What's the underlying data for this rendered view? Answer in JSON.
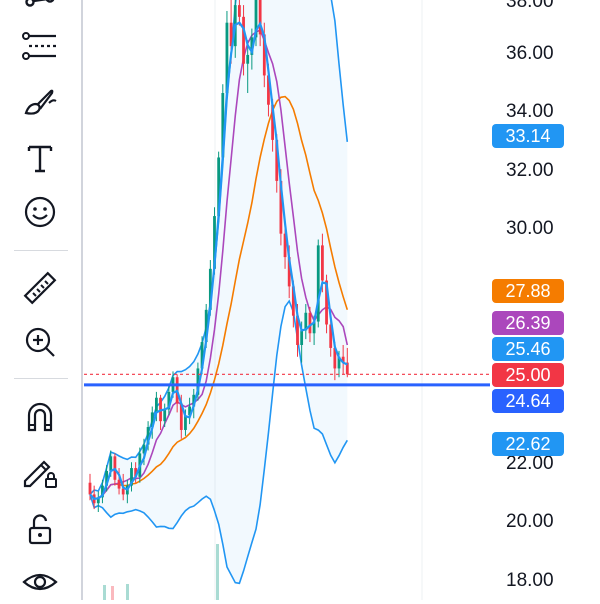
{
  "toolbar": {
    "tools": [
      {
        "name": "trend-line-tool-icon"
      },
      {
        "name": "fib-retracement-tool-icon"
      },
      {
        "name": "brush-tool-icon"
      },
      {
        "name": "text-tool-icon",
        "glyph": "T"
      },
      {
        "name": "emoji-tool-icon"
      },
      {
        "name": "ruler-tool-icon"
      },
      {
        "name": "zoom-in-tool-icon"
      },
      {
        "name": "magnet-tool-icon"
      },
      {
        "name": "lock-drawing-tool-icon"
      },
      {
        "name": "unlock-icon"
      },
      {
        "name": "eye-icon"
      }
    ]
  },
  "price_axis": {
    "labels": [
      "36.00",
      "34.00",
      "32.00",
      "30.00",
      "22.00",
      "20.00",
      "18.00"
    ]
  },
  "price_badges": [
    {
      "value": "33.14",
      "color": "#2196f3"
    },
    {
      "value": "27.88",
      "color": "#f57c00"
    },
    {
      "value": "26.39",
      "color": "#ab47bc"
    },
    {
      "value": "25.46",
      "color": "#2196f3"
    },
    {
      "value": "25.00",
      "color": "#f23645"
    },
    {
      "value": "24.64",
      "color": "#2962ff"
    },
    {
      "value": "22.62",
      "color": "#2196f3"
    }
  ],
  "colors": {
    "up_candle": "#089981",
    "down_candle": "#f23645",
    "bb_band": "#2196f3",
    "ma_fast": "#2196f3",
    "ma_mid": "#ab47bc",
    "ma_slow": "#f57c00",
    "horizontal_line": "#2962ff",
    "current_price_line": "#f23645"
  },
  "chart_data": {
    "type": "candlestick",
    "y_range": [
      17.6,
      38.2
    ],
    "horizontal_line": 24.64,
    "current_price": 25.0,
    "candles": [
      [
        21.3,
        21.6,
        20.7,
        20.9
      ],
      [
        20.9,
        21.2,
        20.4,
        20.6
      ],
      [
        20.6,
        21.0,
        20.3,
        20.8
      ],
      [
        20.8,
        21.4,
        20.6,
        21.2
      ],
      [
        21.2,
        21.9,
        21.0,
        21.7
      ],
      [
        21.7,
        22.4,
        21.5,
        22.2
      ],
      [
        22.2,
        22.3,
        21.2,
        21.4
      ],
      [
        21.4,
        21.8,
        20.9,
        21.1
      ],
      [
        21.1,
        21.6,
        20.7,
        20.9
      ],
      [
        20.9,
        21.4,
        20.6,
        21.2
      ],
      [
        21.2,
        22.0,
        21.0,
        21.8
      ],
      [
        21.8,
        22.0,
        21.3,
        21.5
      ],
      [
        21.5,
        22.5,
        21.3,
        22.3
      ],
      [
        22.3,
        22.8,
        21.9,
        22.6
      ],
      [
        22.6,
        23.4,
        22.4,
        23.2
      ],
      [
        23.2,
        23.9,
        22.8,
        23.7
      ],
      [
        23.7,
        24.4,
        23.4,
        24.2
      ],
      [
        24.2,
        24.3,
        23.1,
        23.4
      ],
      [
        23.4,
        24.0,
        23.2,
        23.8
      ],
      [
        23.8,
        24.6,
        23.6,
        24.4
      ],
      [
        24.4,
        25.1,
        24.2,
        24.9
      ],
      [
        24.9,
        25.0,
        23.7,
        24.0
      ],
      [
        24.0,
        24.3,
        22.8,
        23.1
      ],
      [
        23.1,
        23.8,
        22.9,
        23.6
      ],
      [
        23.6,
        24.2,
        23.3,
        23.9
      ],
      [
        23.9,
        24.5,
        23.5,
        24.3
      ],
      [
        24.3,
        25.4,
        24.1,
        25.2
      ],
      [
        25.2,
        26.3,
        25.0,
        26.1
      ],
      [
        26.1,
        27.4,
        25.9,
        27.2
      ],
      [
        27.2,
        28.9,
        27.0,
        28.6
      ],
      [
        28.6,
        30.7,
        28.4,
        30.4
      ],
      [
        30.4,
        32.6,
        30.2,
        32.4
      ],
      [
        32.4,
        34.9,
        32.2,
        34.6
      ],
      [
        34.6,
        37.4,
        34.4,
        37.0
      ],
      [
        37.0,
        38.3,
        35.6,
        36.2
      ],
      [
        36.2,
        38.3,
        35.8,
        37.6
      ],
      [
        37.6,
        38.3,
        36.9,
        37.2
      ],
      [
        37.2,
        37.6,
        35.2,
        35.6
      ],
      [
        35.6,
        36.4,
        34.6,
        35.9
      ],
      [
        35.9,
        36.8,
        35.4,
        36.5
      ],
      [
        36.5,
        38.3,
        36.2,
        37.8
      ],
      [
        37.8,
        38.3,
        36.2,
        36.6
      ],
      [
        36.6,
        37.0,
        34.8,
        35.2
      ],
      [
        35.2,
        35.6,
        33.8,
        34.2
      ],
      [
        34.2,
        34.4,
        32.6,
        33.0
      ],
      [
        33.0,
        33.2,
        31.2,
        31.6
      ],
      [
        31.6,
        32.0,
        29.4,
        29.8
      ],
      [
        29.8,
        30.2,
        28.6,
        29.0
      ],
      [
        29.0,
        29.4,
        27.6,
        28.0
      ],
      [
        28.0,
        28.2,
        26.6,
        27.0
      ],
      [
        27.0,
        27.4,
        25.6,
        26.0
      ],
      [
        26.0,
        26.8,
        25.4,
        26.5
      ],
      [
        26.5,
        27.4,
        26.2,
        27.1
      ],
      [
        27.1,
        27.3,
        26.1,
        26.4
      ],
      [
        26.4,
        27.0,
        26.0,
        26.8
      ],
      [
        26.8,
        29.6,
        26.6,
        29.4
      ],
      [
        29.4,
        29.8,
        27.8,
        28.2
      ],
      [
        28.2,
        28.4,
        26.4,
        26.7
      ],
      [
        26.7,
        26.9,
        25.6,
        25.9
      ],
      [
        25.9,
        26.1,
        24.8,
        25.2
      ],
      [
        25.2,
        25.8,
        24.9,
        25.6
      ],
      [
        25.6,
        26.0,
        25.0,
        25.4
      ],
      [
        25.4,
        25.9,
        24.9,
        25.0
      ]
    ]
  }
}
